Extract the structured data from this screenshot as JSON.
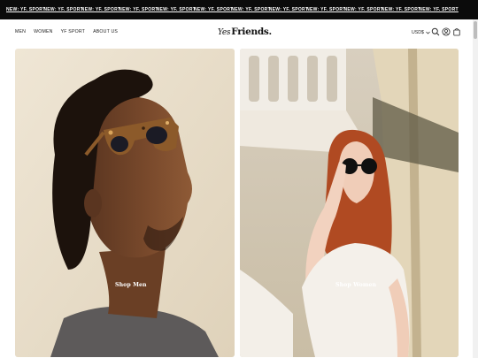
{
  "announcement": {
    "items": [
      "NEW: YF. SPORT",
      "NEW: YF. SPORT",
      "NEW: YF. SPORT",
      "NEW: YF. SPORT",
      "NEW: YF. SPORT",
      "NEW: YF. SPORT",
      "NEW: YF. SPORT",
      "NEW: YF. SPORT",
      "NEW: YF. SPORT",
      "NEW: YF. SPORT",
      "NEW: YF. SPORT",
      "NEW: YF. SPORT"
    ]
  },
  "header": {
    "nav": [
      "MEN",
      "WOMEN",
      "YF SPORT",
      "ABOUT US"
    ],
    "logo_prefix": "Yes",
    "logo_main": "Friends.",
    "currency": "USD$",
    "icons": [
      "chevron-down-icon",
      "search-icon",
      "account-icon",
      "bag-icon"
    ]
  },
  "hero": {
    "left": {
      "label": "Shop Men"
    },
    "right": {
      "label": "Shop Women"
    }
  },
  "colors": {
    "announcement_bg": "#0b0b0b",
    "text": "#222222",
    "panel_left_bg": "#e8ddc8",
    "panel_right_bg": "#d9cdb6"
  }
}
